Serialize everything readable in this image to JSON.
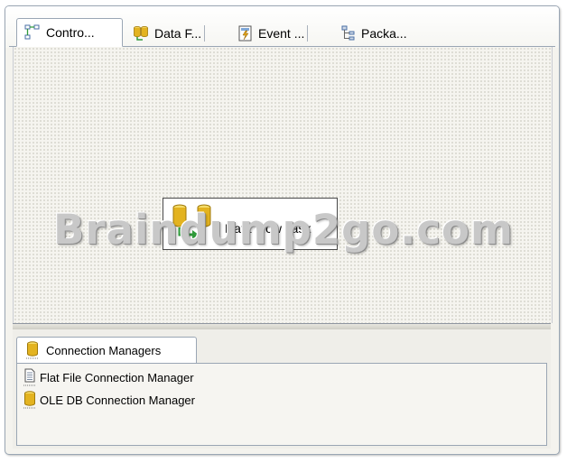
{
  "tabs": [
    {
      "label": "Contro...",
      "icon": "control-flow-icon",
      "active": true
    },
    {
      "label": "Data F...",
      "icon": "data-flow-icon",
      "active": false
    },
    {
      "label": "Event ...",
      "icon": "event-handlers-icon",
      "active": false
    },
    {
      "label": "Packa...",
      "icon": "package-explorer-icon",
      "active": false
    }
  ],
  "designer": {
    "task": {
      "label": "Data Flow Task",
      "icon": "data-flow-task-icon"
    },
    "watermark": "Braindump2go.com"
  },
  "connection_managers": {
    "tab_label": "Connection Managers",
    "tab_icon": "connection-managers-icon",
    "items": [
      {
        "label": "Flat File Connection Manager",
        "icon": "flat-file-icon"
      },
      {
        "label": "OLE DB Connection Manager",
        "icon": "ole-db-icon"
      }
    ]
  },
  "colors": {
    "border": "#9aa6b4",
    "surface": "#f5f4ef",
    "cylinder": "#e3b320",
    "arrow": "#2f9a3a"
  }
}
